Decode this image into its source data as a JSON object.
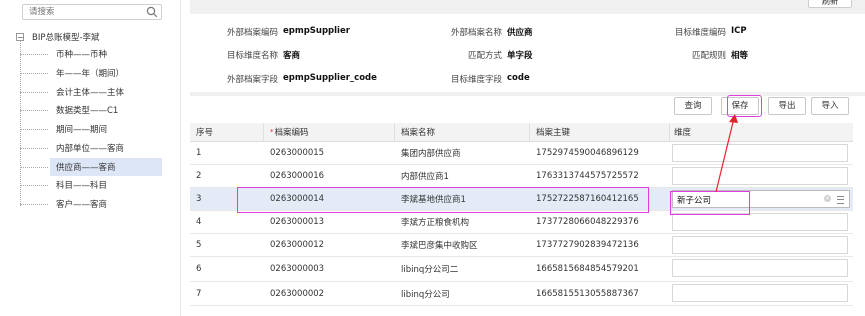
{
  "left": {
    "search_placeholder": "请搜索",
    "root_toggle": "−",
    "root_label": "BIP总账模型-李斌",
    "items": [
      {
        "label": "币种——币种"
      },
      {
        "label": "年——年（期间）"
      },
      {
        "label": "会计主体——主体"
      },
      {
        "label": "数据类型——C1"
      },
      {
        "label": "期间——期间"
      },
      {
        "label": "内部单位——客商"
      },
      {
        "label": "供应商——客商"
      },
      {
        "label": "科目——科目"
      },
      {
        "label": "客户——客商"
      }
    ],
    "selected_index": 6
  },
  "top_button": "刷新",
  "fields": [
    {
      "label": "外部档案编码",
      "value": "epmpSupplier"
    },
    {
      "label": "外部档案名称",
      "value": "供应商"
    },
    {
      "label": "目标维度编码",
      "value": "ICP"
    },
    {
      "label": "目标维度名称",
      "value": "客商"
    },
    {
      "label": "匹配方式",
      "value": "单字段"
    },
    {
      "label": "匹配规则",
      "value": "相等"
    },
    {
      "label": "外部档案字段",
      "value": "epmpSupplier_code"
    },
    {
      "label": "目标维度字段",
      "value": "code"
    }
  ],
  "toolbar": {
    "query": "查询",
    "save": "保存",
    "export": "导出",
    "import": "导入"
  },
  "table": {
    "headers": [
      "序号",
      "档案编码",
      "档案名称",
      "档案主键",
      "维度"
    ],
    "required_mark": "*",
    "rows": [
      {
        "no": "1",
        "code": "0263000015",
        "name": "集团内部供应商",
        "key": "1752974590046896129",
        "dim": ""
      },
      {
        "no": "2",
        "code": "0263000016",
        "name": "内部供应商1",
        "key": "1763313744575725572",
        "dim": ""
      },
      {
        "no": "3",
        "code": "0263000014",
        "name": "李斌基地供应商1",
        "key": "1752722587160412165",
        "dim": "新子公司"
      },
      {
        "no": "4",
        "code": "0263000013",
        "name": "李斌方正粮食机构",
        "key": "1737728066048229376",
        "dim": ""
      },
      {
        "no": "5",
        "code": "0263000012",
        "name": "李斌巴彦集中收购区",
        "key": "1737727902839472136",
        "dim": ""
      },
      {
        "no": "6",
        "code": "0263000003",
        "name": "libinq分公司二",
        "key": "1665815684854579201",
        "dim": ""
      },
      {
        "no": "7",
        "code": "0263000002",
        "name": "libinq分公司",
        "key": "1665815513055887367",
        "dim": ""
      }
    ]
  },
  "colors": {
    "highlight_border": "#e03de0",
    "arrow": "#e8212c",
    "selected_row": "#e4ebf7"
  }
}
